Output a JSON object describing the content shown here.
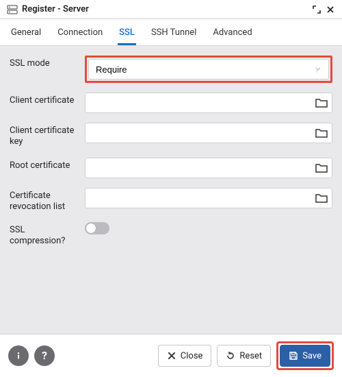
{
  "header": {
    "title": "Register - Server"
  },
  "tabs": [
    "General",
    "Connection",
    "SSL",
    "SSH Tunnel",
    "Advanced"
  ],
  "active_tab": 2,
  "form": {
    "ssl_mode": {
      "label": "SSL mode",
      "value": "Require"
    },
    "client_cert": {
      "label": "Client certificate",
      "value": ""
    },
    "client_cert_key": {
      "label": "Client certificate key",
      "value": ""
    },
    "root_cert": {
      "label": "Root certificate",
      "value": ""
    },
    "crl": {
      "label": "Certificate revocation list",
      "value": ""
    },
    "ssl_compression": {
      "label": "SSL compression?",
      "enabled": false
    }
  },
  "footer": {
    "close": "Close",
    "reset": "Reset",
    "save": "Save"
  }
}
